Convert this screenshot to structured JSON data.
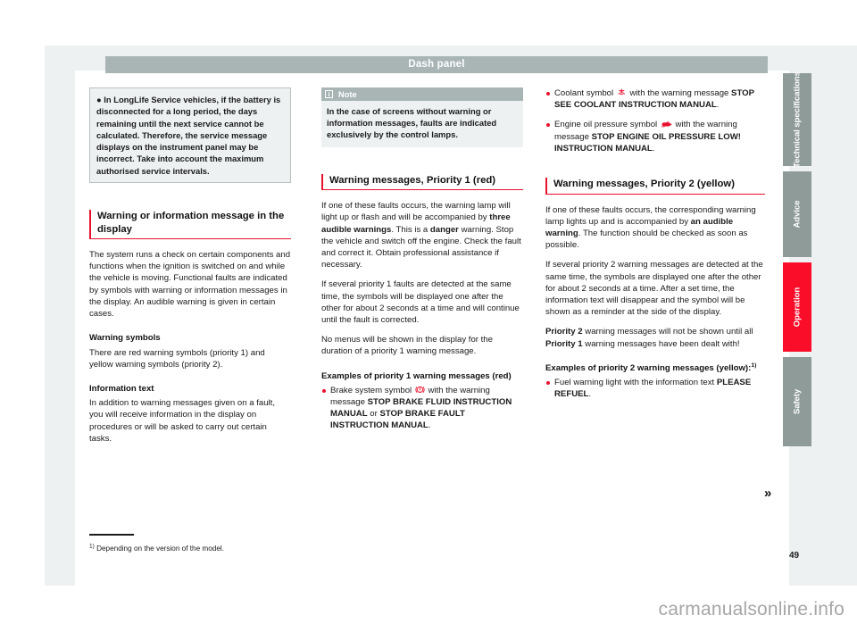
{
  "header": {
    "title": "Dash panel"
  },
  "column1": {
    "grey_box": {
      "bullet": "In LongLife Service vehicles, if the battery is disconnected for a long period, the days remaining until the next service cannot be calculated. Therefore, the service message displays on the instrument panel may be incorrect. Take into account the maximum authorised service intervals."
    },
    "heading": "Warning or information message in the display",
    "p1": "The system runs a check on certain components and functions when the ignition is switched on and while the vehicle is moving. Functional faults are indicated by symbols with warning or information messages in the display. An audible warning is given in certain cases.",
    "sub1": "Warning symbols",
    "p2": "There are red warning symbols (priority 1) and yellow warning symbols (priority 2).",
    "sub2": "Information text",
    "p3": "In addition to warning messages given on a fault, you will receive information in the display on procedures or will be asked to carry out certain tasks."
  },
  "column2": {
    "note": {
      "label": "Note",
      "icon": "info-icon",
      "text": "In the case of screens without warning or information messages, faults are indicated exclusively by the control lamps."
    },
    "heading": "Warning messages, Priority 1 (red)",
    "p1_a": "If one of these faults occurs, the warning lamp will light up or flash and will be accompanied by ",
    "p1_b": "three audible warnings",
    "p1_c": ". This is a ",
    "p1_d": "danger",
    "p1_e": " warning. Stop the vehicle and switch off the engine. Check the fault and correct it. Obtain professional assistance if necessary.",
    "p2": "If several priority 1 faults are detected at the same time, the symbols will be displayed one after the other for about 2 seconds at a time and will continue until the fault is corrected.",
    "p3": "No menus will be shown in the display for the duration of a priority 1 warning message.",
    "sub1": "Examples of priority 1 warning messages (red)",
    "bullet1_a": "Brake system symbol ",
    "bullet1_icon": "brake-warning-icon",
    "bullet1_b": " with the warning message ",
    "bullet1_c": "STOP BRAKE FLUID INSTRUCTION MANUAL",
    "bullet1_d": " or ",
    "bullet1_e": "STOP BRAKE FAULT INSTRUCTION MANUAL",
    "bullet1_f": "."
  },
  "column3": {
    "bullet1_a": "Coolant symbol ",
    "bullet1_icon": "coolant-temperature-icon",
    "bullet1_b": " with the warning message ",
    "bullet1_c": "STOP SEE COOLANT INSTRUCTION MANUAL",
    "bullet1_d": ".",
    "bullet2_a": "Engine oil pressure symbol ",
    "bullet2_icon": "oil-pressure-icon",
    "bullet2_b": " with the warning message ",
    "bullet2_c": "STOP ENGINE OIL PRESSURE LOW! INSTRUCTION MANUAL",
    "bullet2_d": ".",
    "heading": "Warning messages, Priority 2 (yellow)",
    "p1_a": "If one of these faults occurs, the corresponding warning lamp lights up and is accompanied by ",
    "p1_b": "an audible warning",
    "p1_c": ". The function should be checked as soon as possible.",
    "p2": "If several priority 2 warning messages are detected at the same time, the symbols are displayed one after the other for about 2 seconds at a time. After a set time, the information text will disappear and the symbol will be shown as a reminder at the side of the display.",
    "p3_a": "Priority 2",
    "p3_b": " warning messages will not be shown until all ",
    "p3_c": "Priority 1",
    "p3_d": " warning messages have been dealt with!",
    "sub1_a": "Examples of priority 2 warning messages (yellow):",
    "sub1_sup": "1)",
    "bullet3_a": "Fuel warning light with the information text ",
    "bullet3_b": "PLEASE REFUEL",
    "bullet3_c": "."
  },
  "footnote": {
    "marker": "1)",
    "text": "Depending on the version of the model."
  },
  "continuation": {
    "arrow": "»"
  },
  "side_tabs": [
    {
      "label": "Technical specifications",
      "active": false
    },
    {
      "label": "Advice",
      "active": false
    },
    {
      "label": "Operation",
      "active": true
    },
    {
      "label": "Safety",
      "active": false
    }
  ],
  "page_number": "49",
  "watermark": "carmanualsonline.info",
  "colors": {
    "accent_red": "#e8112d",
    "tab_active": "#fa0d28",
    "tab_inactive": "#8e9b99",
    "header_bar": "#a8b5b4",
    "panel_grey": "#eef1f2"
  }
}
